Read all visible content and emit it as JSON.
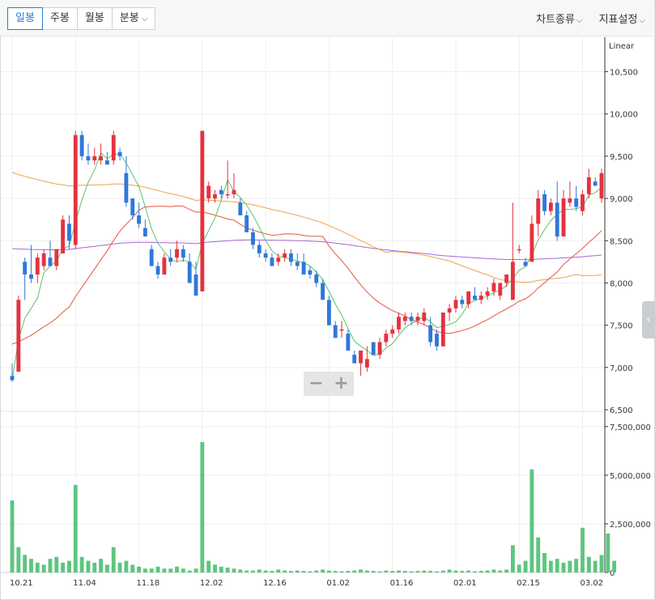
{
  "toolbar": {
    "tabs": [
      {
        "label": "일봉",
        "active": true
      },
      {
        "label": "주봉",
        "active": false
      },
      {
        "label": "월봉",
        "active": false
      },
      {
        "label": "분봉",
        "active": false,
        "dropdown": true
      }
    ],
    "chart_type_label": "차트종류",
    "indicator_label": "지표설정",
    "chevron": "⌵"
  },
  "zoom": {
    "minus": "−",
    "plus": "+"
  },
  "side_handle": "‹",
  "chart_data": {
    "type": "candlestick",
    "scale_label": "Linear",
    "price_ticks": [
      "10,500",
      "10,000",
      "9,500",
      "9,000",
      "8,500",
      "8,000",
      "7,500",
      "7,000",
      "6,500"
    ],
    "price_range": [
      6500,
      10850
    ],
    "volume_ticks": [
      "7,500,000",
      "5,000,000",
      "2,500,000",
      "0"
    ],
    "volume_range": [
      0,
      8200000
    ],
    "x_labels": [
      {
        "label": "10.21",
        "index": 0
      },
      {
        "label": "11.04",
        "index": 10
      },
      {
        "label": "11.18",
        "index": 20
      },
      {
        "label": "12.02",
        "index": 30
      },
      {
        "label": "12.16",
        "index": 40
      },
      {
        "label": "01.02",
        "index": 50
      },
      {
        "label": "01.16",
        "index": 60
      },
      {
        "label": "02.01",
        "index": 70
      },
      {
        "label": "02.15",
        "index": 80
      },
      {
        "label": "03.02",
        "index": 90
      }
    ],
    "colors": {
      "up": "#e5323f",
      "down": "#2f78d8",
      "ma5": "#5cc46a",
      "ma20": "#e5573f",
      "ma60": "#f0a050",
      "ma120": "#a865d8",
      "volume": "#5cc67d"
    },
    "candles": [
      [
        6900,
        7050,
        6830,
        6850
      ],
      [
        6950,
        7850,
        6950,
        7800
      ],
      [
        8250,
        8300,
        7800,
        8100
      ],
      [
        8100,
        8450,
        8000,
        8050
      ],
      [
        8100,
        8350,
        8000,
        8300
      ],
      [
        8200,
        8400,
        8150,
        8350
      ],
      [
        8300,
        8500,
        8200,
        8200
      ],
      [
        8200,
        8400,
        8150,
        8400
      ],
      [
        8350,
        8800,
        8350,
        8750
      ],
      [
        8700,
        8800,
        8400,
        8500
      ],
      [
        8450,
        9800,
        8400,
        9750
      ],
      [
        9750,
        9800,
        9450,
        9500
      ],
      [
        9500,
        9650,
        9400,
        9450
      ],
      [
        9450,
        9600,
        9400,
        9500
      ],
      [
        9450,
        9650,
        9400,
        9500
      ],
      [
        9450,
        9550,
        9400,
        9400
      ],
      [
        9450,
        9800,
        9400,
        9750
      ],
      [
        9550,
        9600,
        9450,
        9500
      ],
      [
        9300,
        9500,
        8900,
        8950
      ],
      [
        9000,
        9000,
        8750,
        8800
      ],
      [
        8800,
        8950,
        8650,
        8700
      ],
      [
        8650,
        8750,
        8550,
        8550
      ],
      [
        8400,
        8450,
        8200,
        8200
      ],
      [
        8200,
        8250,
        8050,
        8100
      ],
      [
        8100,
        8350,
        8100,
        8300
      ],
      [
        8300,
        8400,
        8200,
        8250
      ],
      [
        8300,
        8500,
        8250,
        8400
      ],
      [
        8400,
        8450,
        8250,
        8300
      ],
      [
        8250,
        8350,
        8000,
        8000
      ],
      [
        8100,
        8250,
        7850,
        7850
      ],
      [
        7900,
        9800,
        7900,
        9800
      ],
      [
        9000,
        9200,
        8950,
        9150
      ],
      [
        9000,
        9100,
        8950,
        9050
      ],
      [
        9100,
        9150,
        9000,
        9050
      ],
      [
        9050,
        9450,
        9000,
        9050
      ],
      [
        9050,
        9300,
        9000,
        9100
      ],
      [
        8950,
        9000,
        8800,
        8800
      ],
      [
        8800,
        8850,
        8600,
        8600
      ],
      [
        8600,
        8650,
        8400,
        8450
      ],
      [
        8450,
        8500,
        8300,
        8350
      ],
      [
        8350,
        8400,
        8250,
        8300
      ],
      [
        8300,
        8350,
        8200,
        8200
      ],
      [
        8250,
        8350,
        8200,
        8300
      ],
      [
        8300,
        8400,
        8250,
        8350
      ],
      [
        8350,
        8400,
        8200,
        8250
      ],
      [
        8250,
        8350,
        8150,
        8200
      ],
      [
        8250,
        8350,
        8100,
        8100
      ],
      [
        8150,
        8200,
        8050,
        8100
      ],
      [
        8100,
        8150,
        7950,
        8000
      ],
      [
        8000,
        8050,
        7800,
        7800
      ],
      [
        7800,
        7850,
        7500,
        7500
      ],
      [
        7500,
        7550,
        7350,
        7350
      ],
      [
        7450,
        7550,
        7350,
        7450
      ],
      [
        7400,
        7450,
        7200,
        7200
      ],
      [
        7150,
        7200,
        7050,
        7050
      ],
      [
        7050,
        7200,
        6900,
        7200
      ],
      [
        7000,
        7250,
        6950,
        7100
      ],
      [
        7300,
        7300,
        7150,
        7150
      ],
      [
        7150,
        7350,
        7100,
        7300
      ],
      [
        7300,
        7450,
        7250,
        7400
      ],
      [
        7400,
        7500,
        7350,
        7450
      ],
      [
        7450,
        7650,
        7400,
        7600
      ],
      [
        7550,
        7650,
        7500,
        7600
      ],
      [
        7600,
        7650,
        7500,
        7550
      ],
      [
        7550,
        7650,
        7500,
        7600
      ],
      [
        7550,
        7700,
        7500,
        7650
      ],
      [
        7500,
        7600,
        7250,
        7300
      ],
      [
        7400,
        7450,
        7200,
        7250
      ],
      [
        7250,
        7650,
        7250,
        7650
      ],
      [
        7650,
        7750,
        7550,
        7700
      ],
      [
        7700,
        7850,
        7650,
        7800
      ],
      [
        7800,
        7850,
        7700,
        7750
      ],
      [
        7750,
        7900,
        7700,
        7900
      ],
      [
        7850,
        7950,
        7800,
        7800
      ],
      [
        7800,
        7900,
        7750,
        7850
      ],
      [
        7850,
        7950,
        7800,
        7900
      ],
      [
        7900,
        8050,
        7850,
        8000
      ],
      [
        7850,
        8000,
        7800,
        8000
      ],
      [
        8000,
        8100,
        7950,
        8100
      ],
      [
        7800,
        8950,
        7800,
        8250
      ],
      [
        8400,
        8450,
        8350,
        8400
      ],
      [
        8250,
        8300,
        8200,
        8200
      ],
      [
        8250,
        8800,
        8250,
        8700
      ],
      [
        8700,
        9100,
        8550,
        9000
      ],
      [
        9050,
        9100,
        8800,
        8850
      ],
      [
        8850,
        9000,
        8800,
        8950
      ],
      [
        8950,
        9200,
        8500,
        8550
      ],
      [
        8550,
        9100,
        8550,
        9000
      ],
      [
        8950,
        9200,
        8900,
        9000
      ],
      [
        9000,
        9150,
        8850,
        8900
      ],
      [
        8850,
        9100,
        8800,
        9050
      ],
      [
        9050,
        9350,
        9000,
        9250
      ],
      [
        9200,
        9250,
        9150,
        9150
      ],
      [
        9000,
        9350,
        8950,
        9300
      ]
    ],
    "volumes": [
      3700000,
      1300000,
      900000,
      700000,
      500000,
      400000,
      700000,
      800000,
      500000,
      600000,
      4500000,
      800000,
      600000,
      500000,
      700000,
      400000,
      1300000,
      500000,
      600000,
      400000,
      300000,
      200000,
      200000,
      300000,
      200000,
      200000,
      300000,
      200000,
      100000,
      200000,
      6700000,
      600000,
      400000,
      300000,
      250000,
      200000,
      150000,
      100000,
      100000,
      150000,
      100000,
      80000,
      150000,
      100000,
      80000,
      100000,
      80000,
      60000,
      100000,
      150000,
      100000,
      80000,
      60000,
      80000,
      100000,
      150000,
      100000,
      80000,
      60000,
      100000,
      80000,
      100000,
      80000,
      60000,
      80000,
      100000,
      80000,
      60000,
      100000,
      150000,
      100000,
      80000,
      100000,
      60000,
      80000,
      100000,
      150000,
      100000,
      150000,
      1400000,
      400000,
      600000,
      5300000,
      1800000,
      1000000,
      600000,
      700000,
      500000,
      600000,
      700000,
      2300000,
      800000,
      600000,
      900000,
      2000000,
      600000
    ]
  }
}
